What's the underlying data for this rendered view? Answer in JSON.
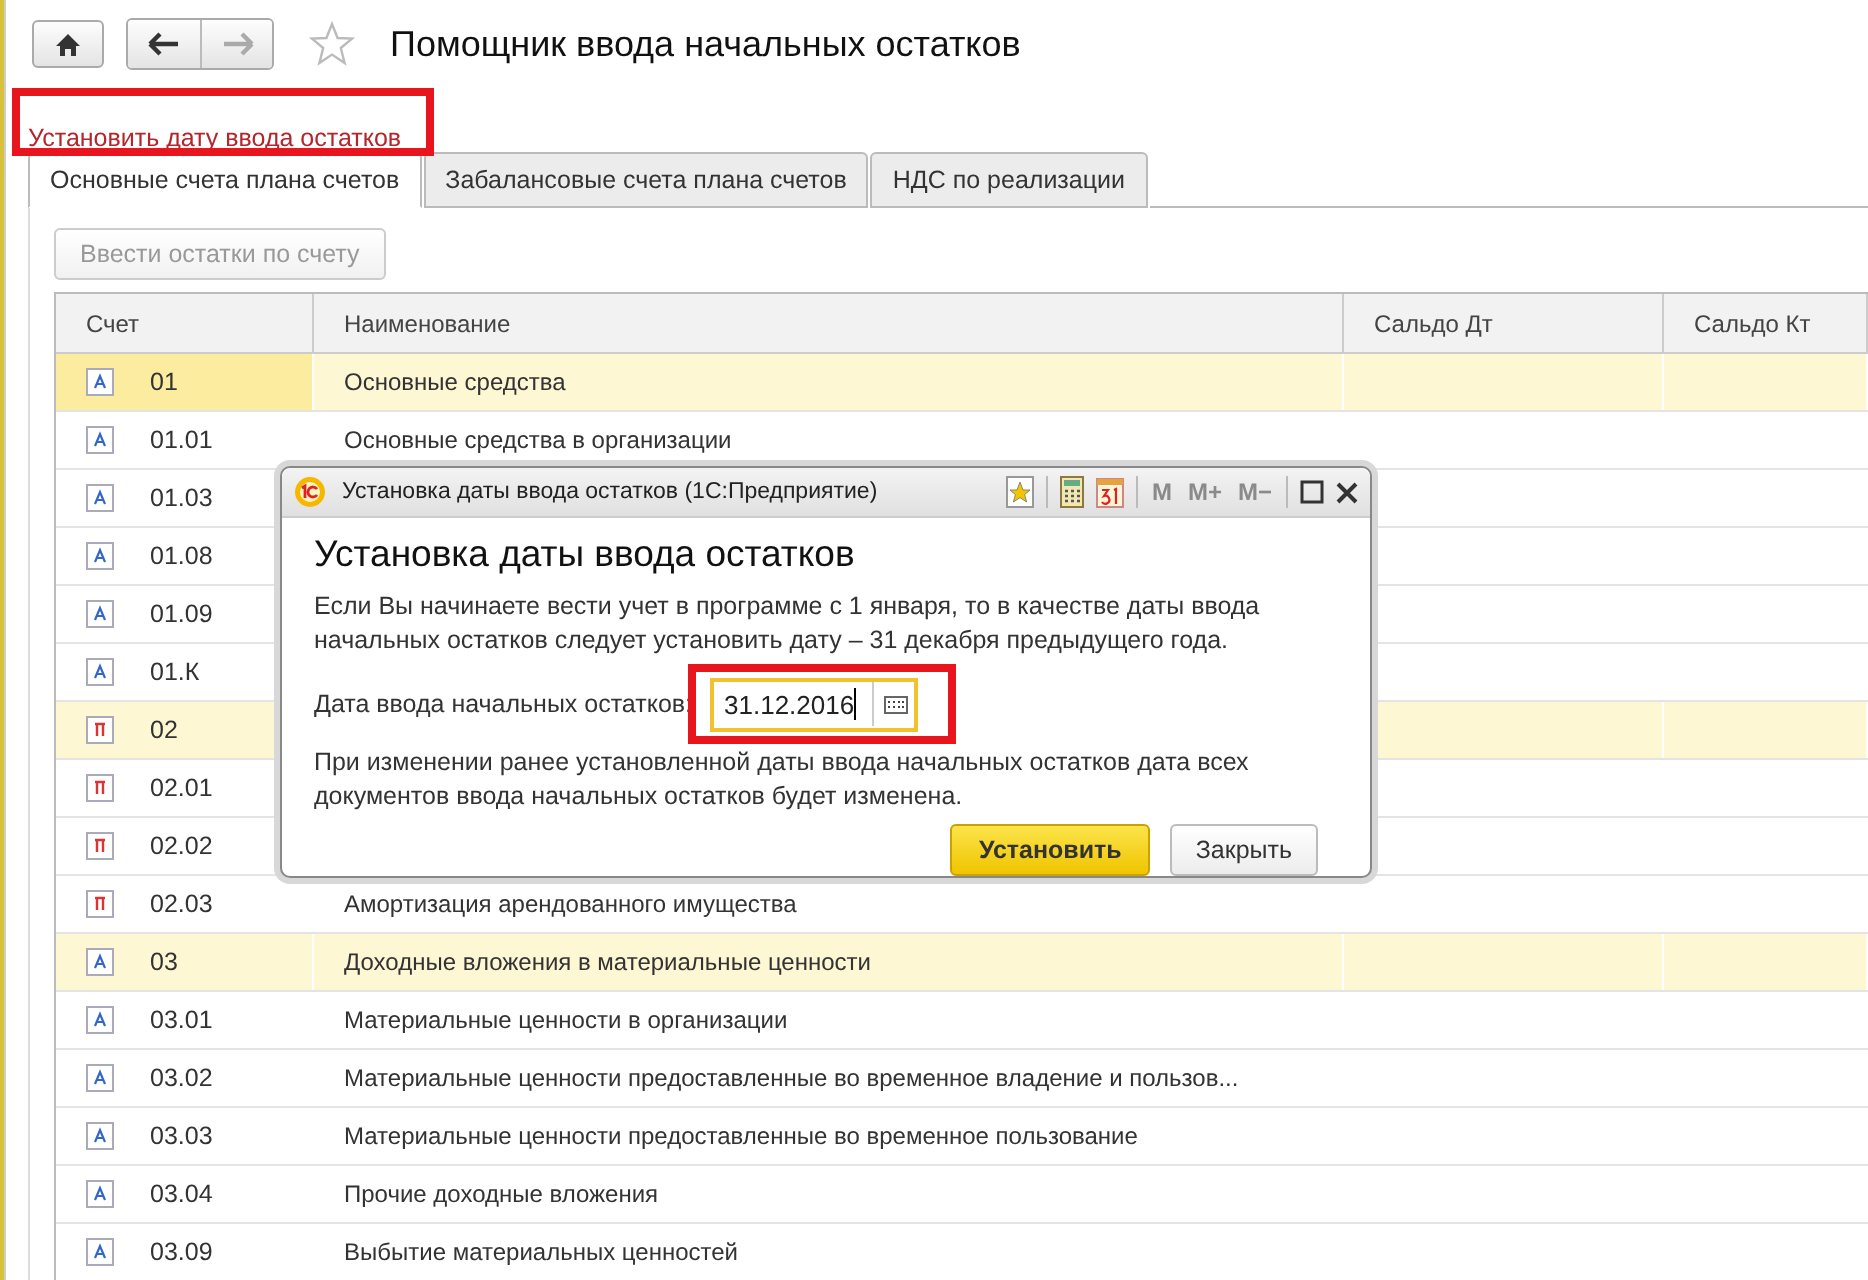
{
  "page": {
    "title": "Помощник ввода начальных остатков",
    "favorite": false
  },
  "set_date_link": {
    "label": "Установить дату ввода остатков",
    "highlighted": true
  },
  "tabs": [
    {
      "label": "Основные счета плана счетов",
      "selected": true
    },
    {
      "label": "Забалансовые счета плана счетов",
      "selected": false
    },
    {
      "label": "НДС по реализации",
      "selected": false
    }
  ],
  "enter_balances_button": {
    "label": "Ввести остатки по счету",
    "disabled": true
  },
  "table": {
    "columns": [
      "Счет",
      "Наименование",
      "Сальдо Дт",
      "Сальдо Кт"
    ],
    "rows": [
      {
        "kind": "active",
        "group": true,
        "selected": true,
        "code": "01",
        "name": "Основные средства"
      },
      {
        "kind": "active",
        "group": false,
        "selected": false,
        "code": "01.01",
        "name": "Основные средства в организации"
      },
      {
        "kind": "active",
        "group": false,
        "selected": false,
        "code": "01.03"
      },
      {
        "kind": "active",
        "group": false,
        "selected": false,
        "code": "01.08"
      },
      {
        "kind": "active",
        "group": false,
        "selected": false,
        "code": "01.09"
      },
      {
        "kind": "active",
        "group": false,
        "selected": false,
        "code": "01.К"
      },
      {
        "kind": "passive",
        "group": true,
        "selected": false,
        "code": "02"
      },
      {
        "kind": "passive",
        "group": false,
        "selected": false,
        "code": "02.01"
      },
      {
        "kind": "passive",
        "group": false,
        "selected": false,
        "code": "02.02"
      },
      {
        "kind": "passive",
        "group": false,
        "selected": false,
        "code": "02.03",
        "name": "Амортизация арендованного имущества"
      },
      {
        "kind": "active",
        "group": true,
        "selected": false,
        "code": "03",
        "name": "Доходные вложения в материальные ценности"
      },
      {
        "kind": "active",
        "group": false,
        "selected": false,
        "code": "03.01",
        "name": "Материальные ценности в организации"
      },
      {
        "kind": "active",
        "group": false,
        "selected": false,
        "code": "03.02",
        "name": "Материальные ценности предоставленные во временное владение и пользов..."
      },
      {
        "kind": "active",
        "group": false,
        "selected": false,
        "code": "03.03",
        "name": "Материальные ценности предоставленные во временное пользование"
      },
      {
        "kind": "active",
        "group": false,
        "selected": false,
        "code": "03.04",
        "name": "Прочие доходные вложения"
      },
      {
        "kind": "active",
        "group": false,
        "selected": false,
        "code": "03.09",
        "name": "Выбытие материальных ценностей"
      }
    ]
  },
  "dialog": {
    "window_title": "Установка даты ввода остатков  (1С:Предприятие)",
    "toolbar": [
      {
        "label": "M",
        "disabled": true
      },
      {
        "label": "M+",
        "disabled": true
      },
      {
        "label": "M−",
        "disabled": true
      }
    ],
    "heading": "Установка даты ввода остатков",
    "intro": "Если Вы начинаете вести учет в программе с 1 января, то в качестве даты ввода начальных остатков следует установить дату – 31 декабря предыдущего года.",
    "date_label": "Дата ввода начальных остатков:",
    "date_value": "31.12.2016",
    "date_highlighted": true,
    "note": "При изменении ранее установленной даты ввода начальных остатков дата всех документов ввода начальных остатков будет изменена.",
    "buttons": [
      {
        "kind": "primary",
        "label": "Установить"
      },
      {
        "kind": "default",
        "label": "Закрыть"
      }
    ]
  }
}
